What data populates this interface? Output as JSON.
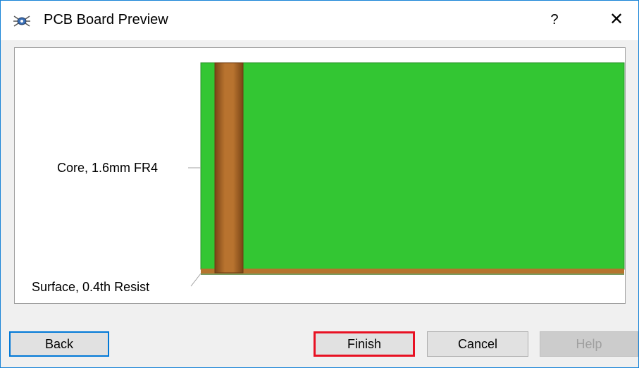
{
  "window": {
    "title": "PCB Board Preview",
    "help_label": "?",
    "close_label": "✕"
  },
  "preview": {
    "layers": [
      {
        "label": "Core, 1.6mm FR4"
      },
      {
        "label": "Surface, 0.4th Resist"
      }
    ],
    "colors": {
      "core": "#33c633",
      "surface": "#b5742e",
      "via_dark": "#7a4516",
      "via_light": "#b8732f"
    }
  },
  "buttons": {
    "back": "Back",
    "finish": "Finish",
    "cancel": "Cancel",
    "help": "Help"
  },
  "icons": {
    "app": "pcb-bug-icon"
  }
}
